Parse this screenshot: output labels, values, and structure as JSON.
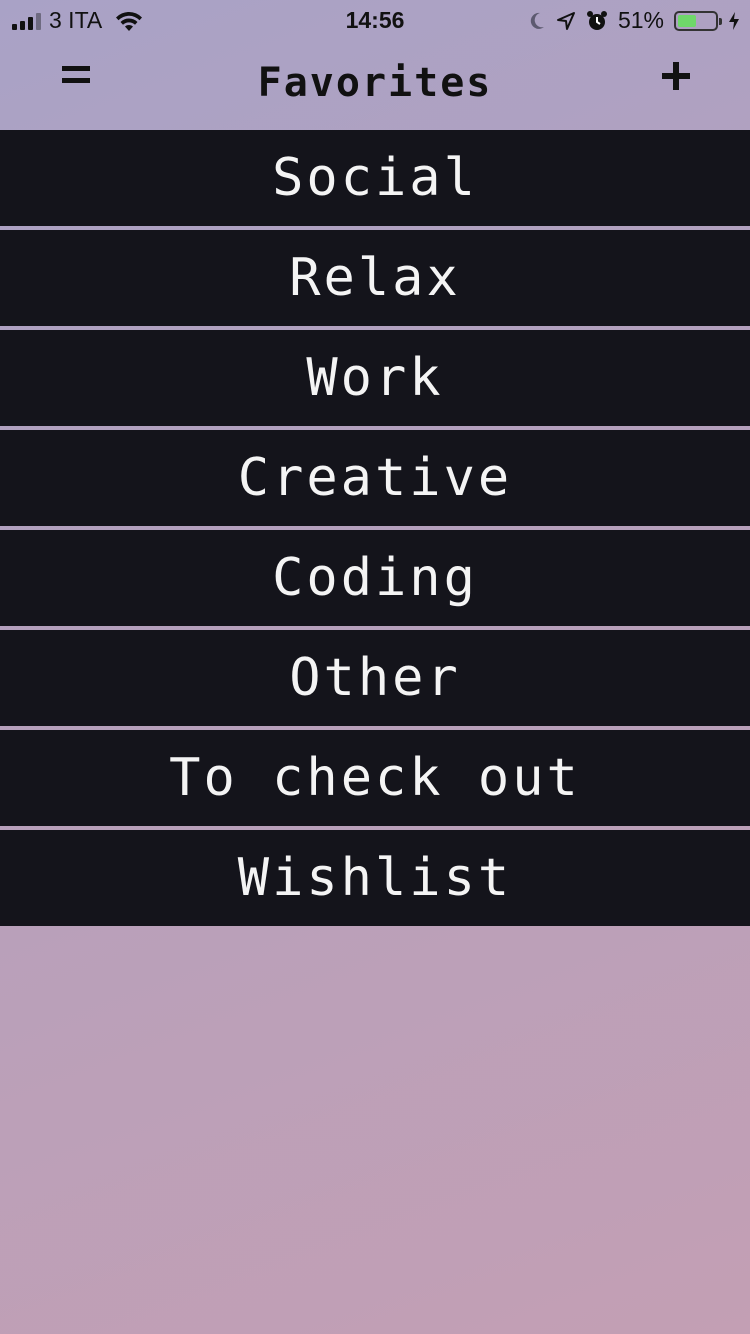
{
  "status_bar": {
    "carrier": "3 ITA",
    "time": "14:56",
    "battery_percent": "51%",
    "battery_level": 0.51,
    "battery_color": "#6fd86a",
    "icons": [
      "signal-icon",
      "wifi-icon",
      "moon-icon",
      "location-icon",
      "alarm-icon",
      "battery-icon",
      "charging-icon"
    ]
  },
  "nav": {
    "title": "Favorites",
    "menu_icon": "menu-icon",
    "add_icon": "plus-icon"
  },
  "colors": {
    "row_background": "#14141b",
    "row_text": "#f4f4f4",
    "background_top": "#a9a2c6",
    "background_bottom": "#c39fb4"
  },
  "categories": [
    {
      "label": "Social"
    },
    {
      "label": "Relax"
    },
    {
      "label": "Work"
    },
    {
      "label": "Creative"
    },
    {
      "label": "Coding"
    },
    {
      "label": "Other"
    },
    {
      "label": "To check out"
    },
    {
      "label": "Wishlist"
    }
  ]
}
